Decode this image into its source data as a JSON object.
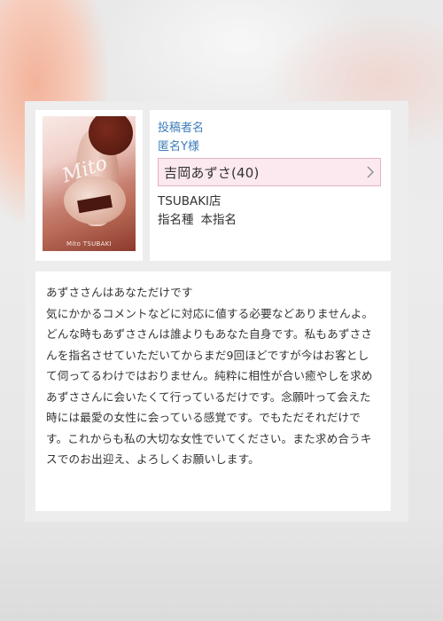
{
  "poster": {
    "label": "投稿者名",
    "name": "匿名Y様"
  },
  "cast": {
    "name": "吉岡あずさ(40)",
    "link_icon": "chevron-right-icon"
  },
  "store": "TSUBAKI店",
  "nomination": {
    "label": "指名種",
    "value": "本指名"
  },
  "photo": {
    "watermark": "Mito TSUBAKI"
  },
  "review": {
    "text": "あずささんはあなただけです\n気にかかるコメントなどに対応に値する必要などありませんよ。どんな時もあずささんは誰よりもあなた自身です。私もあずささんを指名させていただいてからまだ9回ほどですが今はお客として伺ってるわけではおりません。純粋に相性が合い癒やしを求めあずささんに会いたくて行っているだけです。念願叶って会えた時には最愛の女性に会っている感覚です。でもただそれだけです。これからも私の大切な女性でいてください。また求め合うキスでのお出迎え、よろしくお願いします。"
  },
  "colors": {
    "link": "#3d7dbb",
    "cast_bg": "#fbe9ef",
    "cast_border": "#e3b2c1"
  }
}
